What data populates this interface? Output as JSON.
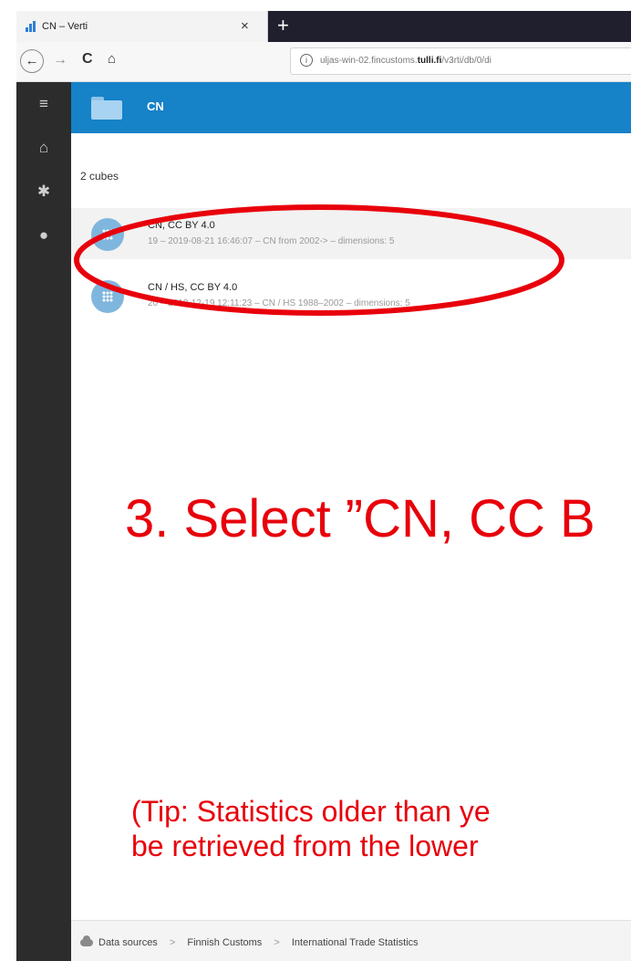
{
  "browser": {
    "tab_title": "CN – Verti",
    "close_symbol": "×",
    "new_tab_symbol": "+",
    "back_symbol": "←",
    "forward_symbol": "→",
    "reload_symbol": "C",
    "home_symbol": "⌂",
    "url_prefix": "uljas-win-02.fincustoms.",
    "url_domain": "tulli.fi",
    "url_path": "/v3rti/db/0/di"
  },
  "app": {
    "folder_title": "CN",
    "cube_count": "2 cubes",
    "cubes": [
      {
        "title": "CN, CC BY 4.0",
        "subtitle": "19 – 2019-08-21 16:46:07 – CN from 2002-> – dimensions: 5"
      },
      {
        "title": "CN / HS, CC BY 4.0",
        "subtitle": "20 – 2018-12-19 12:11:23 – CN / HS 1988–2002 – dimensions: 5"
      }
    ],
    "breadcrumbs": [
      "Data sources",
      "Finnish Customs",
      "International Trade Statistics"
    ],
    "breadcrumb_sep": ">"
  },
  "annotation": {
    "instruction": "3. Select ”CN, CC B",
    "tip_line1": "(Tip: Statistics older than ye",
    "tip_line2": "be retrieved from the lower",
    "color": "#e8000b"
  },
  "colors": {
    "topbar": "#1682c8",
    "sidebar": "#2c2c2c"
  }
}
